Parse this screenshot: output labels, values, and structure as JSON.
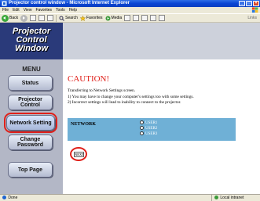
{
  "window": {
    "title": "Projector control window - Microsoft Internet Explorer",
    "min_glyph": "_",
    "max_glyph": "□",
    "close_glyph": "×"
  },
  "menubar": {
    "items": [
      "File",
      "Edit",
      "View",
      "Favorites",
      "Tools",
      "Help"
    ]
  },
  "toolbar": {
    "back_label": "Back",
    "search_label": "Search",
    "favorites_label": "Favorites",
    "media_label": "Media",
    "links_label": "Links"
  },
  "sidebar": {
    "logo_lines": [
      "Projector",
      "Control",
      "Window"
    ],
    "menu_label": "MENU",
    "buttons": [
      {
        "label": "Status"
      },
      {
        "label": "Projector Control"
      },
      {
        "label": "Network Setting"
      },
      {
        "label": "Change Password"
      },
      {
        "label": "Top Page"
      }
    ]
  },
  "main": {
    "heading": "CAUTION!",
    "message_lines": [
      "Transferring to Network Settings screen.",
      "1)  You may have to change your computer's settings too with some settings.",
      "2)  Incorrect settings will lead to inability to connect to the projector."
    ],
    "network_label": "NETWORK",
    "network_options": [
      "USER1",
      "USER2",
      "USER3"
    ],
    "next_label": "NEXT"
  },
  "statusbar": {
    "left": "Done",
    "zone": "Local intranet"
  },
  "colors": {
    "caution": "#e0201a",
    "network_box": "#6fb0d6",
    "logo_bg": "#2a3a7a",
    "sidebar_bg": "#b3b7c6"
  }
}
